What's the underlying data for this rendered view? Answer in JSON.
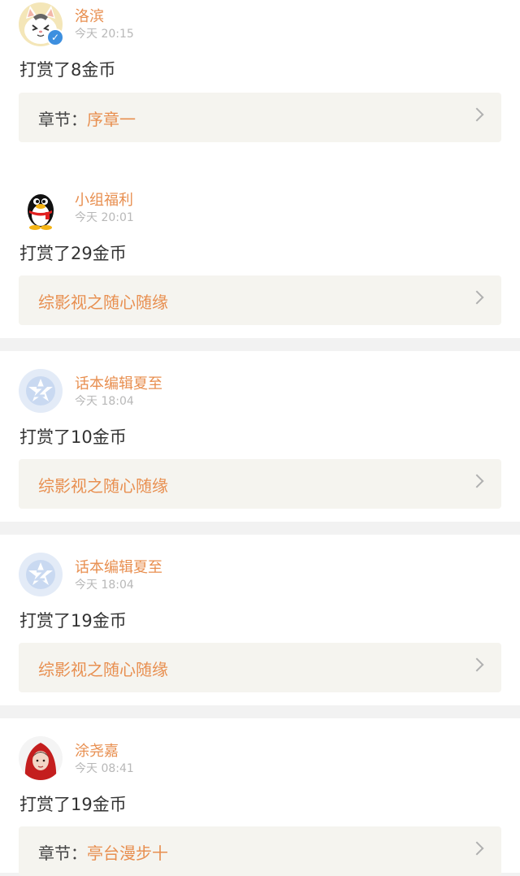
{
  "feed": [
    {
      "avatar": "cat-avatar-icon",
      "verified": true,
      "name": "洛滨",
      "time": "今天 20:15",
      "reward": "打赏了8金币",
      "chapter_prefix": "章节：",
      "chapter_title": "序章一"
    },
    {
      "avatar": "qq-penguin-avatar-icon",
      "verified": false,
      "name": "小组福利",
      "time": "今天 20:01",
      "reward": "打赏了29金币",
      "chapter_prefix": "",
      "chapter_title": "综影视之随心随缘"
    },
    {
      "avatar": "default-z-avatar-icon",
      "verified": false,
      "name": "话本编辑夏至",
      "time": "今天 18:04",
      "reward": "打赏了10金币",
      "chapter_prefix": "",
      "chapter_title": "综影视之随心随缘"
    },
    {
      "avatar": "default-z-avatar-icon",
      "verified": false,
      "name": "话本编辑夏至",
      "time": "今天 18:04",
      "reward": "打赏了19金币",
      "chapter_prefix": "",
      "chapter_title": "综影视之随心随缘"
    },
    {
      "avatar": "red-hood-avatar-icon",
      "verified": false,
      "name": "涂尧嘉",
      "time": "今天 08:41",
      "reward": "打赏了19金币",
      "chapter_prefix": "章节：",
      "chapter_title": "亭台漫步十"
    }
  ],
  "colors": {
    "accent": "#e88f50",
    "timestamp": "#b8b8b8",
    "text": "#333333",
    "chapter_bg": "#f5f4ef",
    "page_bg": "#f2f2f2",
    "verified": "#3d8fdf"
  },
  "icons": {
    "verified": "verified-badge-icon",
    "chevron": "chevron-right-icon"
  }
}
